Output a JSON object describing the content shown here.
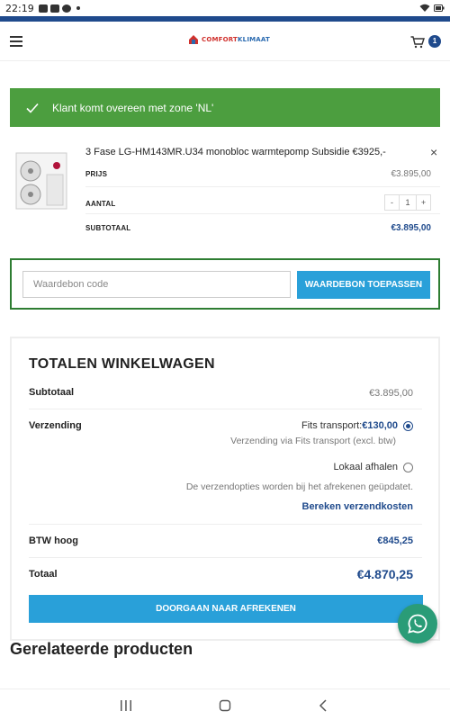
{
  "status_bar": {
    "time": "22:19"
  },
  "header": {
    "logo": {
      "part1": "COMFORT",
      "part2": "KLIMAAT"
    },
    "cart_count": "1"
  },
  "notice": {
    "text": "Klant komt overeen met zone 'NL'"
  },
  "cart_item": {
    "title": "3 Fase LG-HM143MR.U34 monobloc warmtepomp Subsidie €3925,-",
    "remove": "×",
    "price_label": "PRIJS",
    "price": "€3.895,00",
    "qty_label": "AANTAL",
    "qty_minus": "-",
    "qty_value": "1",
    "qty_plus": "+",
    "subtotal_label": "SUBTOTAAL",
    "subtotal": "€3.895,00"
  },
  "coupon": {
    "placeholder": "Waardebon code",
    "apply_label": "WAARDEBON TOEPASSEN"
  },
  "totals": {
    "heading": "TOTALEN WINKELWAGEN",
    "subtotal_label": "Subtotaal",
    "subtotal_value": "€3.895,00",
    "shipping_label": "Verzending",
    "shipping_option1_name": "Fits transport: ",
    "shipping_option1_price": "€130,00",
    "shipping_option1_note": "Verzending via Fits transport (excl. btw)",
    "shipping_option2_name": "Lokaal afhalen",
    "shipping_note": "De verzendopties worden bij het afrekenen geüpdatet.",
    "calculate_link": "Bereken verzendkosten",
    "vat_label": "BTW hoog",
    "vat_value": "€845,25",
    "total_label": "Totaal",
    "total_value": "€4.870,25",
    "checkout_label": "DOORGAAN NAAR AFREKENEN"
  },
  "related": {
    "heading": "Gerelateerde producten"
  },
  "colors": {
    "brand_blue": "#1f4a8c",
    "button_blue": "#29a0d9",
    "success_green": "#4c9e3f",
    "whatsapp_green": "#2a9c77"
  }
}
